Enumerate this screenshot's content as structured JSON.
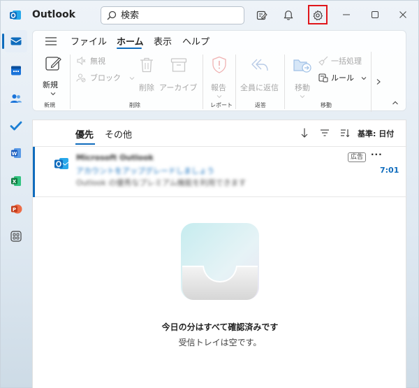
{
  "app": {
    "title": "Outlook"
  },
  "search": {
    "placeholder": "検索"
  },
  "ribbon": {
    "tabs": [
      "ファイル",
      "ホーム",
      "表示",
      "ヘルプ"
    ],
    "active_tab": "ホーム",
    "new_label": "新規",
    "ignore_label": "無視",
    "block_label": "ブロック",
    "delete_label": "削除",
    "archive_label": "アーカイブ",
    "report_label": "報告",
    "reply_all_label": "全員に返信",
    "move_label": "移動",
    "sweep_label": "一括処理",
    "rules_label": "ルール",
    "groups": [
      "新規",
      "削除",
      "レポート",
      "返答",
      "移動"
    ]
  },
  "list": {
    "tabs": [
      "優先",
      "その他"
    ],
    "active_tab": "優先",
    "sort_label": "基準: 日付",
    "message": {
      "sender": "Microsoft Outlook",
      "subject": "アカウントをアップグレードしましょう",
      "preview": "Outlook の優秀なプレミアム機能を利用できます",
      "badge": "広告",
      "more": "···",
      "time": "7:01"
    },
    "empty_title": "今日の分はすべて確認済みです",
    "empty_subtitle": "受信トレイは空です。"
  },
  "colors": {
    "accent": "#0f6cbd",
    "highlight": "#e0161b"
  }
}
